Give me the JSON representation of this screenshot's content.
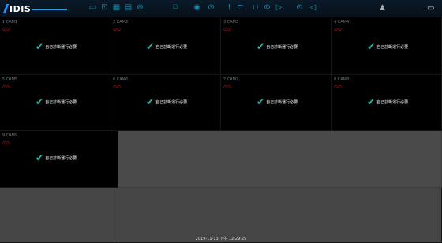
{
  "app": {
    "title": "IDIS"
  },
  "toolbar": {
    "icons": [
      "monitor-icon",
      "display-icon",
      "grid-icon",
      "layout-icon",
      "settings-icon",
      "window-icon",
      "record-icon",
      "search-icon",
      "alarm-icon",
      "export-icon",
      "play-icon",
      "zoom-icon",
      "snapshot-icon"
    ]
  },
  "cameras": [
    {
      "label": "1 CAM1",
      "icons": "⊙⊙",
      "status": "自己診斷運行必要"
    },
    {
      "label": "2 CAM2",
      "icons": "⊙⊙",
      "status": "自己診斷運行必要"
    },
    {
      "label": "3 CAM3",
      "icons": "⊙⊙",
      "status": "自己診斷運行必要"
    },
    {
      "label": "4 CAM4",
      "icons": "⊙⊙",
      "status": "自己診斷運行必要"
    },
    {
      "label": "5 CAM5",
      "icons": "⊙⊙",
      "status": "自己診斷運行必要"
    },
    {
      "label": "6 CAM6",
      "icons": "⊙⊙",
      "status": "自己診斷運行必要"
    },
    {
      "label": "7 CAM7",
      "icons": "⊙⊙",
      "status": "自己診斷運行必要"
    },
    {
      "label": "8 CAM8",
      "icons": "⊙⊙",
      "status": "自己診斷運行必要"
    },
    {
      "label": "9 CAM9",
      "icons": "⊙⊙",
      "status": "自己診斷運行必要"
    }
  ],
  "footer": {
    "timestamp": "2019-11-13 下午 12:29:25"
  }
}
